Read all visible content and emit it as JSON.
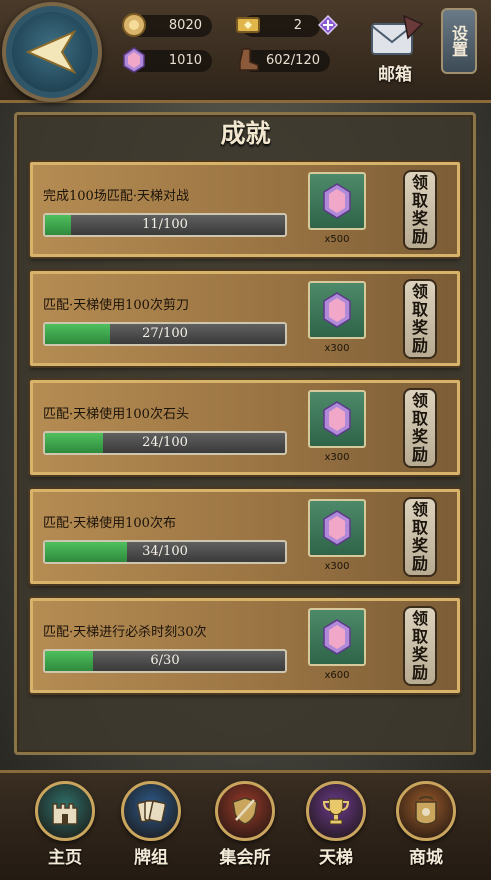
{
  "header": {
    "resources": [
      {
        "name": "coin",
        "value": "8020"
      },
      {
        "name": "ticket",
        "value": "2"
      },
      {
        "name": "gem",
        "value": "1010"
      },
      {
        "name": "stamina",
        "value": "602/120"
      }
    ],
    "mail_label": "邮箱",
    "settings_label": "设置"
  },
  "panel": {
    "title": "成就"
  },
  "achievements": [
    {
      "title": "完成100场匹配·天梯对战",
      "progress_text": "11/100",
      "progress": 0.11,
      "reward": "x500",
      "claim_label": "领取奖励"
    },
    {
      "title": "匹配·天梯使用100次剪刀",
      "progress_text": "27/100",
      "progress": 0.27,
      "reward": "x300",
      "claim_label": "领取奖励"
    },
    {
      "title": "匹配·天梯使用100次石头",
      "progress_text": "24/100",
      "progress": 0.24,
      "reward": "x300",
      "claim_label": "领取奖励"
    },
    {
      "title": "匹配·天梯使用100次布",
      "progress_text": "34/100",
      "progress": 0.34,
      "reward": "x300",
      "claim_label": "领取奖励"
    },
    {
      "title": "匹配·天梯进行必杀时刻30次",
      "progress_text": "6/30",
      "progress": 0.2,
      "reward": "x600",
      "claim_label": "领取奖励"
    }
  ],
  "nav": [
    {
      "label": "主页",
      "icon": "castle-icon",
      "color": "#2f6f6a"
    },
    {
      "label": "牌组",
      "icon": "cards-icon",
      "color": "#2d5a8a"
    },
    {
      "label": "集会所",
      "icon": "shield-icon",
      "color": "#9a3a2a"
    },
    {
      "label": "天梯",
      "icon": "trophy-icon",
      "color": "#6a3a8a"
    },
    {
      "label": "商城",
      "icon": "shop-icon",
      "color": "#9a5a2a"
    }
  ]
}
